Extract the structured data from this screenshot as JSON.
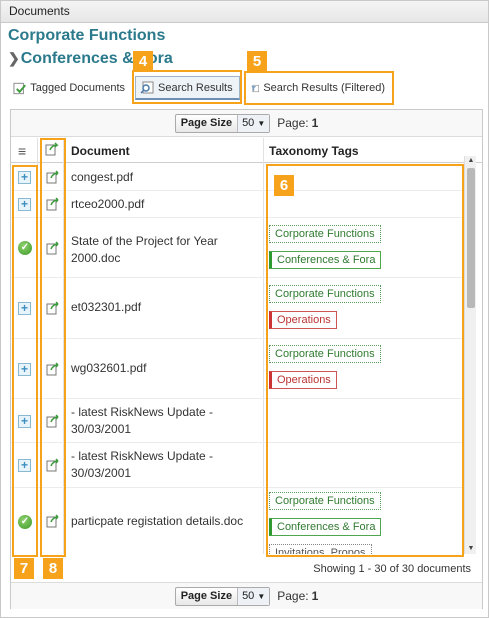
{
  "panel": {
    "title": "Documents"
  },
  "breadcrumb": {
    "level1": "Corporate Functions",
    "level2": "Conferences & Fora",
    "chevron": "❯"
  },
  "tabs": [
    {
      "label": "Tagged Documents",
      "icon": "tag-doc-icon"
    },
    {
      "label": "Search Results",
      "icon": "search-doc-icon",
      "active": true
    },
    {
      "label": "Search Results (Filtered)",
      "icon": "filter-doc-icon"
    }
  ],
  "pager": {
    "page_size_label": "Page Size",
    "page_size_value": "50",
    "page_label": "Page:",
    "page_value": "1"
  },
  "columns": {
    "menu": "≡",
    "document": "Document",
    "taxonomy": "Taxonomy Tags"
  },
  "rows": [
    {
      "state": "plus",
      "doc": "congest.pdf",
      "tags": []
    },
    {
      "state": "plus",
      "doc": "rtceo2000.pdf",
      "tags": []
    },
    {
      "state": "check",
      "doc": "State of the Project for Year 2000.doc",
      "tags": [
        {
          "label": "Corporate Functions",
          "style": "dotted"
        },
        {
          "label": "Conferences & Fora",
          "style": "green"
        }
      ]
    },
    {
      "state": "plus",
      "doc": "et032301.pdf",
      "tags": [
        {
          "label": "Corporate Functions",
          "style": "dotted"
        },
        {
          "label": "Operations",
          "style": "red"
        }
      ]
    },
    {
      "state": "plus",
      "doc": "wg032601.pdf",
      "tags": [
        {
          "label": "Corporate Functions",
          "style": "dotted"
        },
        {
          "label": "Operations",
          "style": "red"
        }
      ]
    },
    {
      "state": "plus",
      "doc": "- latest RiskNews Update - 30/03/2001",
      "tags": []
    },
    {
      "state": "plus",
      "doc": "- latest RiskNews Update - 30/03/2001",
      "tags": []
    },
    {
      "state": "check",
      "doc": "particpate registation details.doc",
      "tags": [
        {
          "label": "Corporate Functions",
          "style": "dotted"
        },
        {
          "label": "Conferences & Fora",
          "style": "green"
        },
        {
          "label": "Invitations, Propos",
          "style": "grey"
        }
      ]
    }
  ],
  "status": "Showing 1 - 30 of 30 documents",
  "callouts": [
    "4",
    "5",
    "6",
    "7",
    "8"
  ],
  "colors": {
    "accent": "#f7a21b",
    "heading": "#2b7a8c",
    "tag_green": "#2f9a2f",
    "tag_red": "#cc3333"
  }
}
